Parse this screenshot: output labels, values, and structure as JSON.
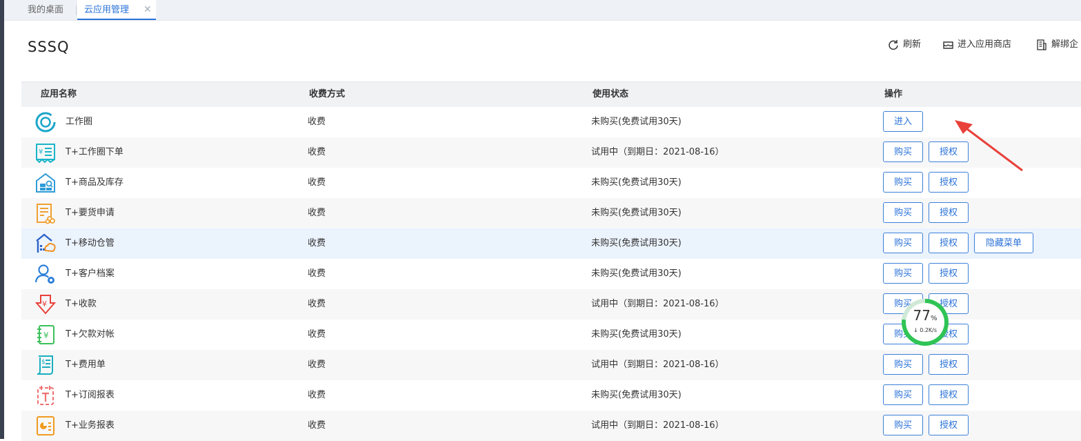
{
  "tabs": [
    {
      "label": "我的桌面"
    },
    {
      "label": "云应用管理",
      "close": "✕"
    }
  ],
  "page": {
    "title": "SSSQ"
  },
  "toolbar": {
    "refresh": "刷新",
    "store": "进入应用商店",
    "unbind": "解绑企"
  },
  "table": {
    "headers": {
      "name": "应用名称",
      "fee": "收费方式",
      "status": "使用状态",
      "ops": "操作"
    },
    "rows": [
      {
        "name": "工作圈",
        "fee": "收费",
        "status": "未购买(免费试用30天)",
        "icon": "workcircle-icon",
        "btn1": "进入"
      },
      {
        "name": "T+工作圈下单",
        "fee": "收费",
        "status": "试用中（到期日：2021-08-16）",
        "icon": "order-icon",
        "btn1": "购买",
        "btn2": "授权"
      },
      {
        "name": "T+商品及库存",
        "fee": "收费",
        "status": "未购买(免费试用30天)",
        "icon": "inventory-icon",
        "btn1": "购买",
        "btn2": "授权"
      },
      {
        "name": "T+要货申请",
        "fee": "收费",
        "status": "未购买(免费试用30天)",
        "icon": "request-icon",
        "btn1": "购买",
        "btn2": "授权"
      },
      {
        "name": "T+移动仓管",
        "fee": "收费",
        "status": "未购买(免费试用30天)",
        "icon": "warehouse-icon",
        "btn1": "购买",
        "btn2": "授权",
        "btn3": "隐藏菜单"
      },
      {
        "name": "T+客户档案",
        "fee": "收费",
        "status": "未购买(免费试用30天)",
        "icon": "customer-icon",
        "btn1": "购买",
        "btn2": "授权"
      },
      {
        "name": "T+收款",
        "fee": "收费",
        "status": "试用中（到期日：2021-08-16）",
        "icon": "receipt-icon",
        "btn1": "购买",
        "btn2": "授权"
      },
      {
        "name": "T+欠款对帐",
        "fee": "收费",
        "status": "未购买(免费试用30天)",
        "icon": "debt-icon",
        "btn1": "购买",
        "btn2": "授权"
      },
      {
        "name": "T+费用单",
        "fee": "收费",
        "status": "试用中（到期日：2021-08-16）",
        "icon": "expense-icon",
        "btn1": "购买",
        "btn2": "授权"
      },
      {
        "name": "T+订阅报表",
        "fee": "收费",
        "status": "未购买(免费试用30天)",
        "icon": "subscribe-report-icon",
        "btn1": "购买",
        "btn2": "授权"
      },
      {
        "name": "T+业务报表",
        "fee": "收费",
        "status": "试用中（到期日：2021-08-16）",
        "icon": "business-report-icon",
        "btn1": "购买",
        "btn2": "授权"
      }
    ]
  },
  "speed_widget": {
    "percent": "77",
    "percent_sign": "%",
    "rate": "↓ 0.2K/s"
  },
  "colors": {
    "accent": "#2a72d8",
    "arrow": "#e8413a",
    "speed_ring": "#2fc455"
  }
}
